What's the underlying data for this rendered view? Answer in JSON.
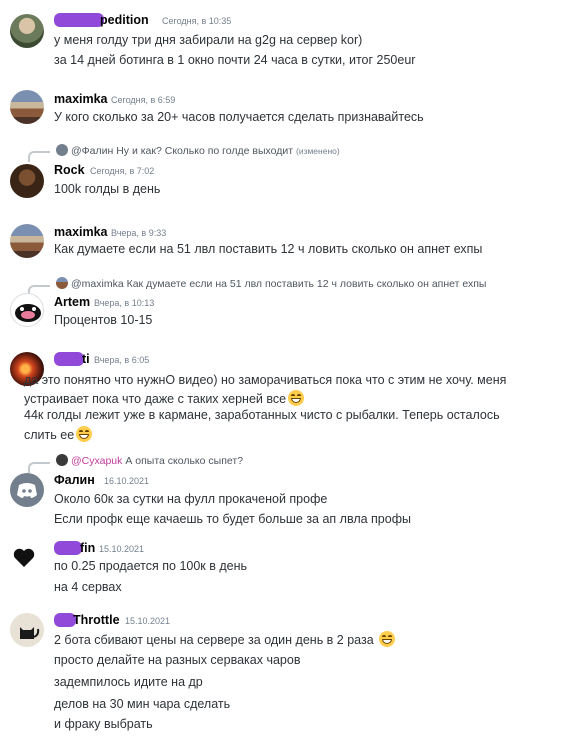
{
  "messages": [
    {
      "author": "pedition",
      "timestamp": "Сегодня, в 10:35",
      "lines": [
        "у меня голду три дня забирали на g2g на сервер kor)",
        "за 14 дней ботинга в 1 окно почти 24 часа в сутки, итог 250eur"
      ]
    },
    {
      "author": "maximka",
      "timestamp": "Сегодня, в 6:59",
      "lines": [
        "У кого сколько за 20+ часов получается сделать признавайтесь"
      ]
    },
    {
      "reply": {
        "author": "@Фалин",
        "text": "Ну и как? Сколько по голде выходит",
        "edited": "(изменено)"
      },
      "author": "Rock",
      "timestamp": "Сегодня, в 7:02",
      "lines": [
        "100k голды в день"
      ]
    },
    {
      "author": "maximka",
      "timestamp": "Вчера, в 9:33",
      "lines": [
        "Как думаете если на 51 лвл поставить 12 ч ловить сколько он апнет ехпы"
      ]
    },
    {
      "reply": {
        "author": "@maximka",
        "text": "Как думаете если на 51 лвл поставить 12 ч ловить сколько он апнет ехпы"
      },
      "author": "Artem",
      "timestamp": "Вчера, в 10:13",
      "lines": [
        "Процентов 10-15"
      ]
    },
    {
      "author": "ti",
      "timestamp": "Вчера, в 6:05",
      "lines": [
        "да это понятно что нужнО видео) но заморачиваться пока что с этим не хочу. меня",
        "устраивает  пока что даже с таких херней все",
        "44к голды лежит уже в кармане, заработанных чисто с рыбалки. Теперь осталось",
        "слить ее"
      ]
    },
    {
      "reply": {
        "author": "@Сухарuk",
        "text": "А опыта сколько сыпет?"
      },
      "author": "Фалин",
      "timestamp": "16.10.2021",
      "lines": [
        "Около 60к за сутки на фулл прокаченой профе",
        "Если профк еще качаешь то будет больше за ап лвла профы"
      ]
    },
    {
      "author": "fin",
      "timestamp": "15.10.2021",
      "lines": [
        "по 0.25 продается по 100к в день",
        "на 4 сервах"
      ]
    },
    {
      "author": "Throttle",
      "timestamp": "15.10.2021",
      "lines": [
        "2 бота сбивают цены на сервере за один день в 2 раза",
        "просто делайте на разных серваках чаров",
        "задемпилось идите на др",
        "делов на 30 мин чара сделать",
        "и фраку выбрать"
      ]
    }
  ],
  "icons": {
    "emoji": "grinning-face-emoji",
    "discord_logo": "discord-logo-icon",
    "heart": "black-heart-icon"
  },
  "colors": {
    "redaction": "#8b3fd8",
    "background": "#ffffff",
    "text": "#2e3338",
    "timestamp": "#747f8d",
    "mention": "#c23b9e"
  }
}
